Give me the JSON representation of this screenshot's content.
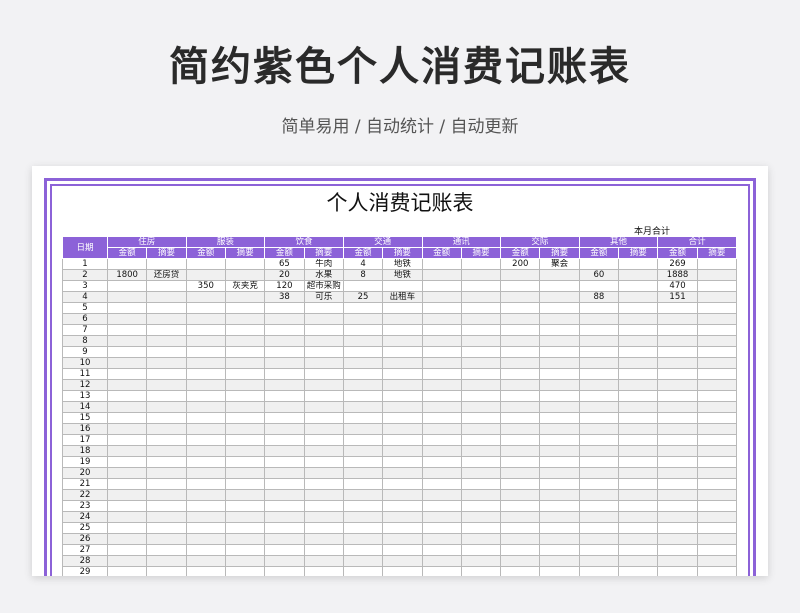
{
  "header": {
    "title": "简约紫色个人消费记账表",
    "subtitle": "简单易用  /  自动统计  /  自动更新"
  },
  "sheet": {
    "title": "个人消费记账表",
    "summary_label": "本月合计",
    "date_header": "日期",
    "categories": [
      "住房",
      "服装",
      "饮食",
      "交通",
      "通讯",
      "交际",
      "其他",
      "合计"
    ],
    "sub_headers": [
      "金额",
      "摘要"
    ],
    "rows": [
      {
        "day": "1",
        "cells": [
          "",
          "",
          "",
          "",
          "65",
          "牛肉",
          "4",
          "地铁",
          "",
          "",
          "200",
          "聚会",
          "",
          "",
          "269",
          ""
        ]
      },
      {
        "day": "2",
        "cells": [
          "1800",
          "还房贷",
          "",
          "",
          "20",
          "水果",
          "8",
          "地铁",
          "",
          "",
          "",
          "",
          "60",
          "",
          "1888",
          ""
        ]
      },
      {
        "day": "3",
        "cells": [
          "",
          "",
          "350",
          "灰夹克",
          "120",
          "超市采购",
          "",
          "",
          "",
          "",
          "",
          "",
          "",
          "",
          "470",
          ""
        ]
      },
      {
        "day": "4",
        "cells": [
          "",
          "",
          "",
          "",
          "38",
          "可乐",
          "25",
          "出租车",
          "",
          "",
          "",
          "",
          "88",
          "",
          "151",
          ""
        ]
      },
      {
        "day": "5",
        "cells": []
      },
      {
        "day": "6",
        "cells": []
      },
      {
        "day": "7",
        "cells": []
      },
      {
        "day": "8",
        "cells": []
      },
      {
        "day": "9",
        "cells": []
      },
      {
        "day": "10",
        "cells": []
      },
      {
        "day": "11",
        "cells": []
      },
      {
        "day": "12",
        "cells": []
      },
      {
        "day": "13",
        "cells": []
      },
      {
        "day": "14",
        "cells": []
      },
      {
        "day": "15",
        "cells": []
      },
      {
        "day": "16",
        "cells": []
      },
      {
        "day": "17",
        "cells": []
      },
      {
        "day": "18",
        "cells": []
      },
      {
        "day": "19",
        "cells": []
      },
      {
        "day": "20",
        "cells": []
      },
      {
        "day": "21",
        "cells": []
      },
      {
        "day": "22",
        "cells": []
      },
      {
        "day": "23",
        "cells": []
      },
      {
        "day": "24",
        "cells": []
      },
      {
        "day": "25",
        "cells": []
      },
      {
        "day": "26",
        "cells": []
      },
      {
        "day": "27",
        "cells": []
      },
      {
        "day": "28",
        "cells": []
      },
      {
        "day": "29",
        "cells": []
      }
    ]
  },
  "colors": {
    "accent": "#8c62d8",
    "alt_row": "#f0f0f0"
  }
}
